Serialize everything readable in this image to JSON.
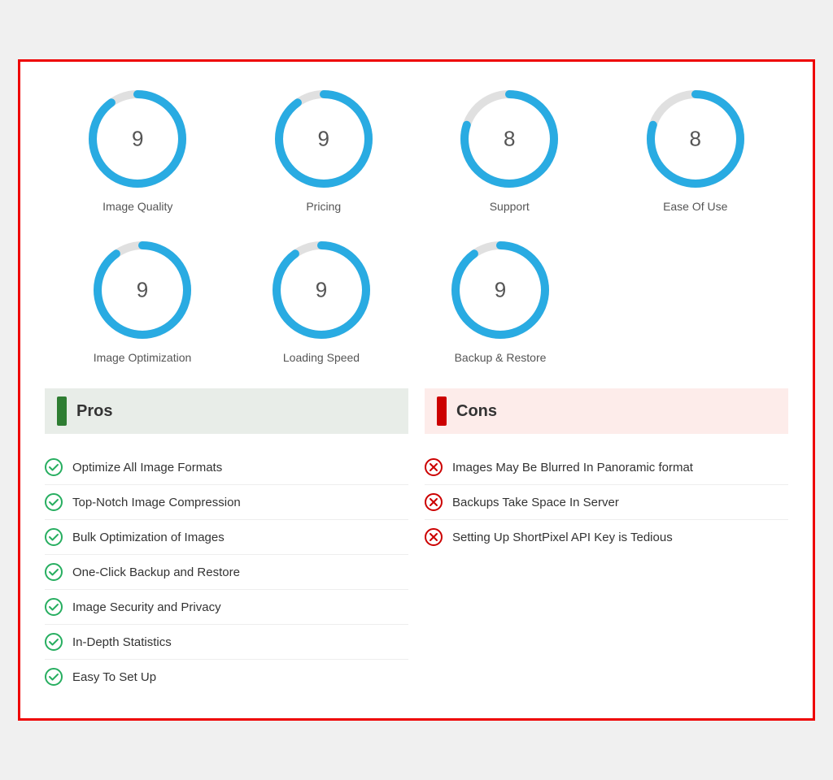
{
  "gauges": {
    "row1": [
      {
        "label": "Image Quality",
        "value": 9,
        "percent": 90
      },
      {
        "label": "Pricing",
        "value": 9,
        "percent": 90
      },
      {
        "label": "Support",
        "value": 8,
        "percent": 80
      },
      {
        "label": "Ease Of Use",
        "value": 8,
        "percent": 80
      }
    ],
    "row2": [
      {
        "label": "Image Optimization",
        "value": 9,
        "percent": 90
      },
      {
        "label": "Loading Speed",
        "value": 9,
        "percent": 90
      },
      {
        "label": "Backup & Restore",
        "value": 9,
        "percent": 90
      }
    ]
  },
  "pros": {
    "header": "Pros",
    "items": [
      "Optimize All Image Formats",
      "Top-Notch Image Compression",
      "Bulk Optimization of Images",
      "One-Click Backup and Restore",
      "Image Security and Privacy",
      "In-Depth Statistics",
      "Easy To Set Up"
    ]
  },
  "cons": {
    "header": "Cons",
    "items": [
      "Images May Be Blurred In Panoramic format",
      "Backups Take Space In Server",
      "Setting Up ShortPixel API Key is Tedious"
    ]
  }
}
